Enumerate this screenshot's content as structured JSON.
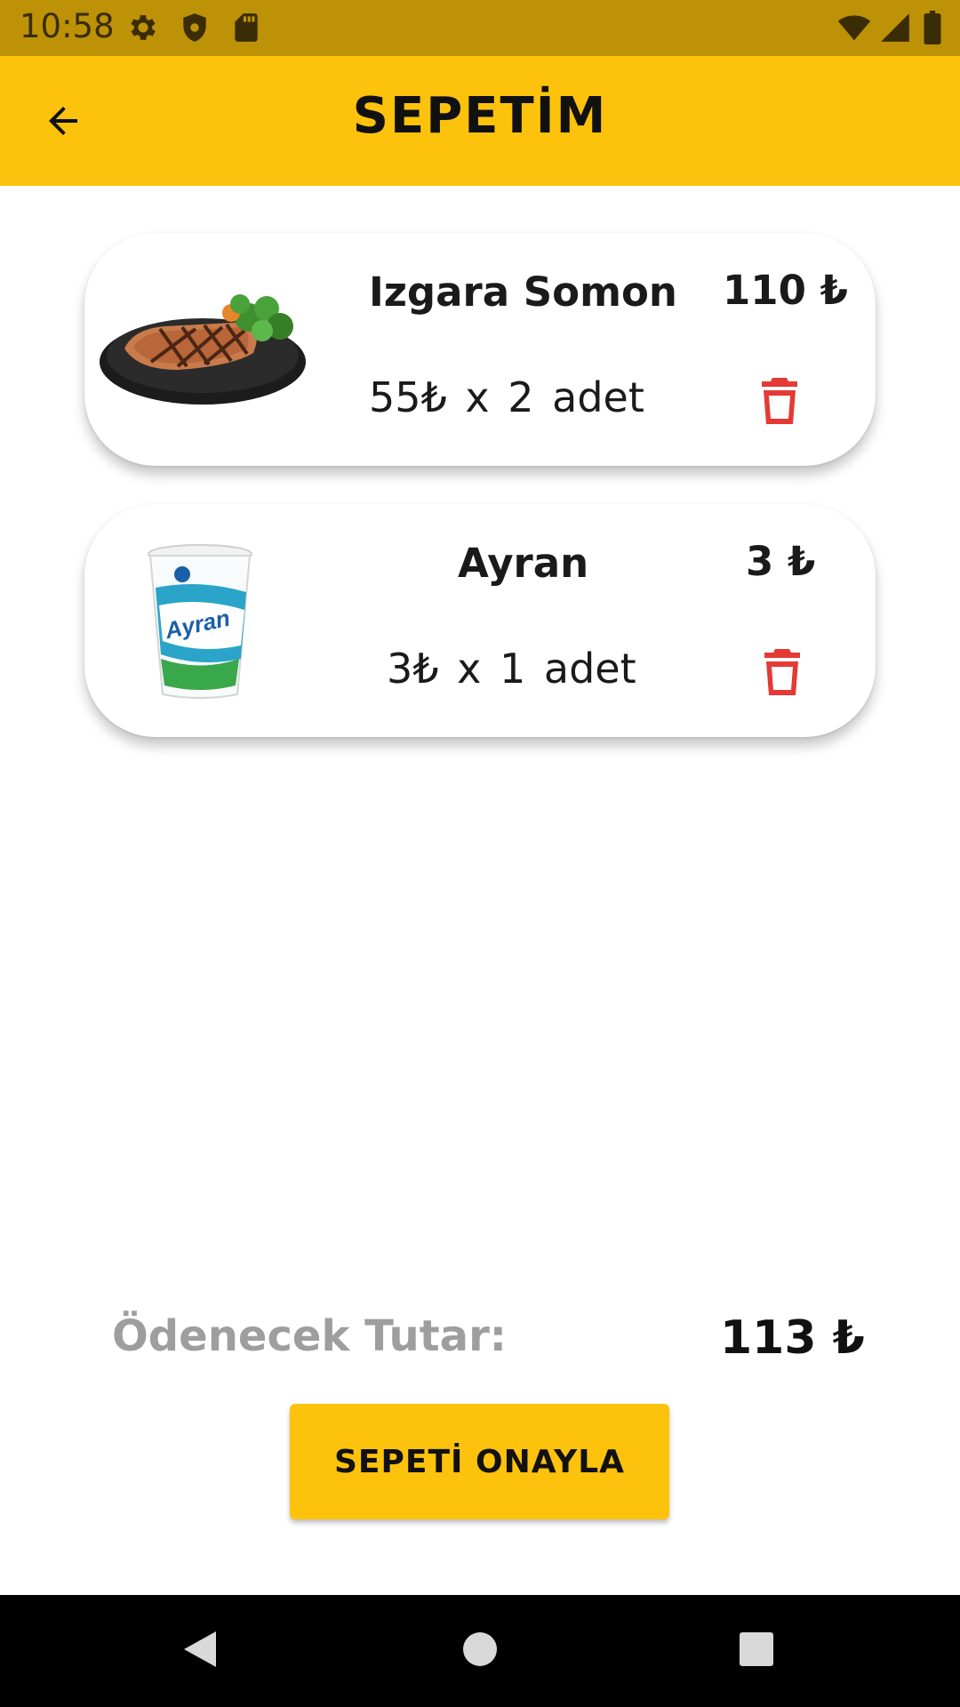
{
  "status_bar": {
    "time": "10:58",
    "icons": [
      "settings-icon",
      "shield-icon",
      "sd-card-icon",
      "wifi-icon",
      "signal-icon",
      "battery-icon"
    ],
    "color": "#BD9207"
  },
  "app_bar": {
    "title": "SEPETİM",
    "back_icon": "arrow-back-icon",
    "color": "#FDC20C"
  },
  "cart": {
    "items": [
      {
        "name": "Izgara Somon",
        "total": "110 ₺",
        "quantity_text": "55₺ x 2 adet",
        "image": "grilled-salmon-plate",
        "delete_icon": "trash-icon"
      },
      {
        "name": "Ayran",
        "total": "3 ₺",
        "quantity_text": "3₺ x 1 adet",
        "image": "ayran-cup",
        "delete_icon": "trash-icon"
      }
    ]
  },
  "summary": {
    "total_label": "Ödenecek Tutar:",
    "total_value": "113 ₺"
  },
  "confirm_button": {
    "label": "SEPETİ ONAYLA"
  },
  "nav_bar": {
    "buttons": [
      "back-triangle-icon",
      "home-circle-icon",
      "recents-square-icon"
    ]
  },
  "colors": {
    "accent": "#FDC20C",
    "delete": "#E53935",
    "muted_text": "#9E9E9E"
  }
}
